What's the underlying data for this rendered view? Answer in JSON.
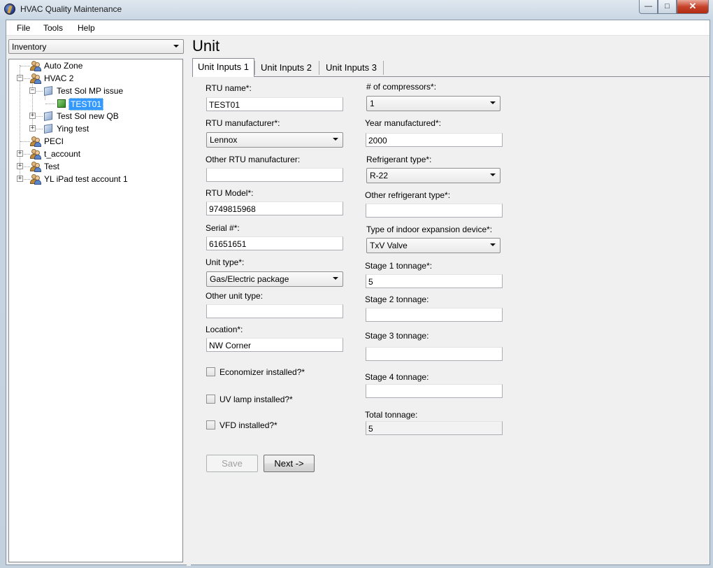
{
  "window": {
    "title": "HVAC Quality Maintenance",
    "min": "—",
    "max": "□",
    "close": "✕"
  },
  "menu": {
    "file": "File",
    "tools": "Tools",
    "help": "Help"
  },
  "sidebar": {
    "dropdown": "Inventory",
    "tree": [
      {
        "label": "Auto Zone",
        "icon": "account-icon"
      },
      {
        "label": "HVAC 2",
        "icon": "account-icon",
        "expander": "−"
      },
      {
        "label": "Test Sol MP issue",
        "icon": "site-icon",
        "expander": "−"
      },
      {
        "label": "TEST01",
        "icon": "unit-icon",
        "selected": true
      },
      {
        "label": "Test Sol new QB",
        "icon": "site-icon",
        "expander": "+"
      },
      {
        "label": "Ying test",
        "icon": "site-icon",
        "expander": "+"
      },
      {
        "label": "PECI",
        "icon": "account-icon"
      },
      {
        "label": "t_account",
        "icon": "account-icon",
        "expander": "+"
      },
      {
        "label": "Test",
        "icon": "account-icon",
        "expander": "+"
      },
      {
        "label": "YL iPad test account 1",
        "icon": "account-icon",
        "expander": "+"
      }
    ]
  },
  "main": {
    "title": "Unit",
    "tabs": [
      "Unit Inputs 1",
      "Unit Inputs 2",
      "Unit Inputs 3"
    ],
    "left": {
      "rtu_name": {
        "label": "RTU name*:",
        "value": "TEST01"
      },
      "rtu_manufacturer": {
        "label": "RTU manufacturer*:",
        "value": "Lennox"
      },
      "other_rtu_manufacturer": {
        "label": "Other RTU manufacturer:",
        "value": ""
      },
      "rtu_model": {
        "label": "RTU Model*:",
        "value": "9749815968"
      },
      "serial": {
        "label": "Serial #*:",
        "value": "61651651"
      },
      "unit_type": {
        "label": "Unit type*:",
        "value": "Gas/Electric package"
      },
      "other_unit_type": {
        "label": "Other unit type:",
        "value": ""
      },
      "location": {
        "label": "Location*:",
        "value": "NW Corner"
      },
      "economizer": {
        "label": "Economizer installed?*",
        "checked": false
      },
      "uv_lamp": {
        "label": "UV lamp installed?*",
        "checked": false
      },
      "vfd": {
        "label": "VFD installed?*",
        "checked": false
      }
    },
    "right": {
      "compressors": {
        "label": "# of compressors*:",
        "value": "1"
      },
      "year_manufactured": {
        "label": "Year manufactured*:",
        "value": "2000"
      },
      "refrigerant_type": {
        "label": "Refrigerant type*:",
        "value": "R-22"
      },
      "other_refrigerant": {
        "label": "Other refrigerant type*:",
        "value": ""
      },
      "expansion_device": {
        "label": "Type of indoor expansion device*:",
        "value": "TxV Valve"
      },
      "stage1": {
        "label": "Stage 1 tonnage*:",
        "value": "5"
      },
      "stage2": {
        "label": "Stage 2 tonnage:",
        "value": ""
      },
      "stage3": {
        "label": "Stage 3 tonnage:",
        "value": ""
      },
      "stage4": {
        "label": "Stage 4 tonnage:",
        "value": ""
      },
      "total": {
        "label": "Total tonnage:",
        "value": "5"
      }
    },
    "buttons": {
      "save": "Save",
      "next": "Next ->"
    }
  }
}
